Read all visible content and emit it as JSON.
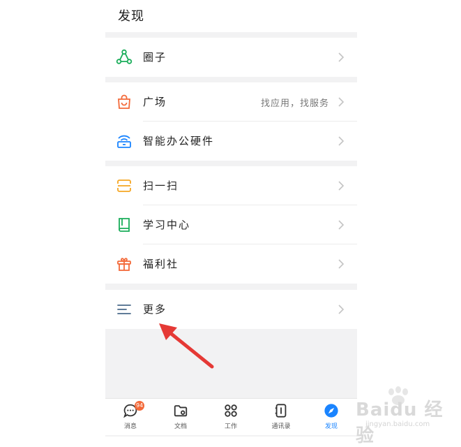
{
  "header": {
    "title": "发现"
  },
  "groups": [
    {
      "items": [
        {
          "label": "圈子",
          "icon": "circle-network-icon",
          "color": "#1aad5a"
        }
      ]
    },
    {
      "items": [
        {
          "label": "广场",
          "sub": "找应用，找服务",
          "icon": "shopping-bag-icon",
          "color": "#f36a3a"
        },
        {
          "label": "智能办公硬件",
          "icon": "router-icon",
          "color": "#1a84ff"
        }
      ]
    },
    {
      "items": [
        {
          "label": "扫一扫",
          "icon": "scan-icon",
          "color": "#f5a623"
        },
        {
          "label": "学习中心",
          "icon": "book-icon",
          "color": "#1aad5a"
        },
        {
          "label": "福利社",
          "icon": "gift-icon",
          "color": "#f36a3a"
        }
      ]
    },
    {
      "items": [
        {
          "label": "更多",
          "icon": "menu-lines-icon",
          "color": "#4a6a8a"
        }
      ]
    }
  ],
  "tabs": [
    {
      "label": "消息",
      "icon": "chat-bubble-icon",
      "badge": "94"
    },
    {
      "label": "文档",
      "icon": "folder-icon"
    },
    {
      "label": "工作",
      "icon": "grid-apps-icon"
    },
    {
      "label": "通讯录",
      "icon": "contacts-book-icon"
    },
    {
      "label": "发现",
      "icon": "compass-icon",
      "active": true
    }
  ],
  "colors": {
    "accent": "#1a84ff",
    "badge": "#f36a3a",
    "annotation_arrow": "#e53935"
  },
  "watermark": {
    "text": "Baidu 经验",
    "sub": "jingyan.baidu.com"
  }
}
